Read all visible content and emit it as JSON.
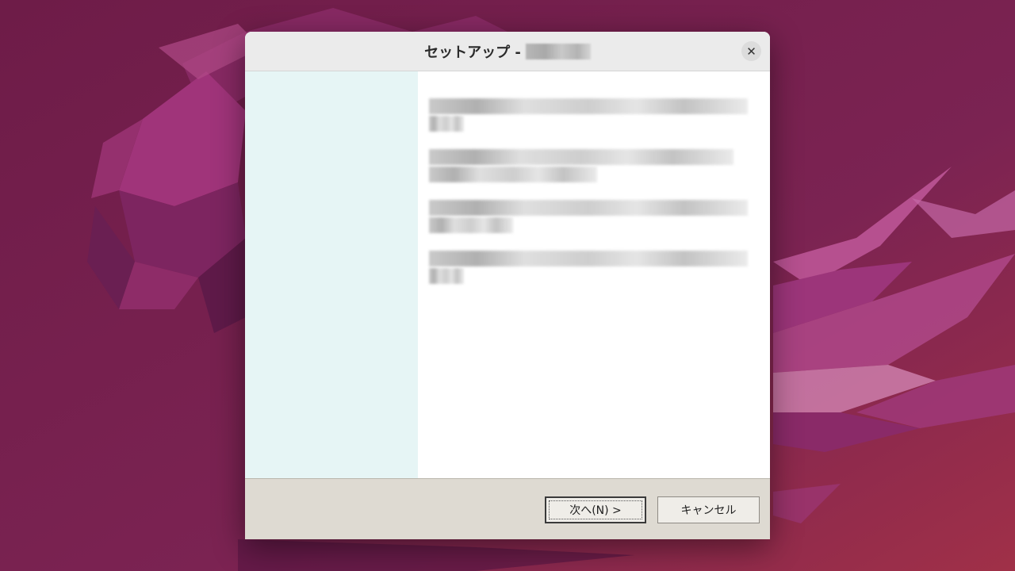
{
  "dialog": {
    "title": "セットアップ -",
    "close_label": "✕"
  },
  "buttons": {
    "next_label": "次へ(N) >",
    "cancel_label": "キャンセル"
  },
  "colors": {
    "wallpaper": "#7a2150",
    "side_panel": "#e6f5f5",
    "button_bar": "#dedad2"
  }
}
